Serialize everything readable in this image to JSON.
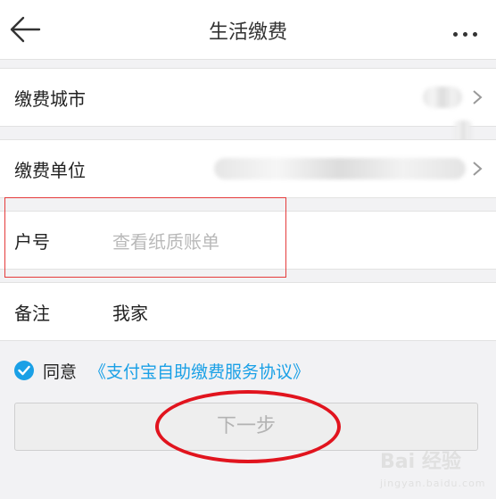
{
  "header": {
    "title": "生活缴费",
    "back_icon": "arrow-left-icon",
    "more_icon": "more-dots-icon"
  },
  "rows": {
    "city": {
      "label": "缴费城市"
    },
    "unit": {
      "label": "缴费单位"
    },
    "account": {
      "label": "户号",
      "placeholder": "查看纸质账单"
    },
    "note": {
      "label": "备注",
      "value": "我家"
    }
  },
  "agreement": {
    "prefix": "同意",
    "link": "《支付宝自助缴费服务协议》",
    "checked": true
  },
  "next_button": {
    "label": "下一步",
    "enabled": false
  },
  "watermark": {
    "brand": "Bai 经验",
    "url": "jingyan.baidu.com"
  },
  "colors": {
    "accent": "#1aa0e6",
    "annotation_red": "#e1141e",
    "disabled_text": "#b3b3b3"
  }
}
